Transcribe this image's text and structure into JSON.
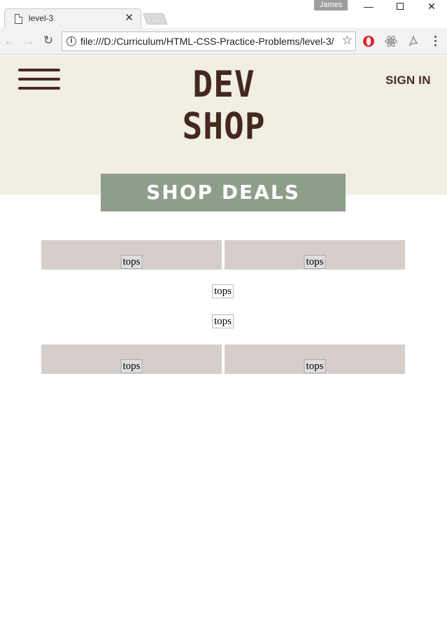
{
  "browser": {
    "tab_title": "level-3",
    "profile_name": "James",
    "url": "file:///D:/Curriculum/HTML-CSS-Practice-Problems/level-3/",
    "icons": {
      "back": "arrow-left-icon",
      "forward": "arrow-right-icon",
      "reload": "reload-icon",
      "info": "info-icon",
      "bookmark": "star-icon",
      "menu": "more-vert-icon"
    }
  },
  "site": {
    "brand": "DEV SHOP",
    "sign_in": "SIGN IN",
    "cta": "SHOP DEALS",
    "colors": {
      "hero_bg": "#f1eee4",
      "brand_text": "#44281f",
      "cta_bg": "#8f9e8a",
      "cell_bg": "#d6ceca"
    }
  },
  "products": {
    "row1": [
      "tops",
      "tops"
    ],
    "center": [
      "tops",
      "tops"
    ],
    "row2": [
      "tops",
      "tops"
    ]
  }
}
